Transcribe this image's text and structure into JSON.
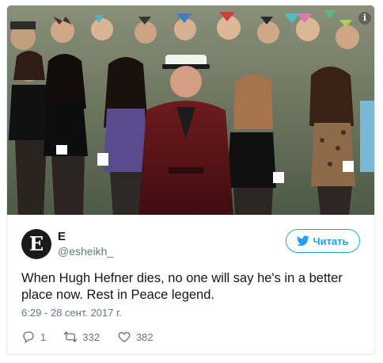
{
  "media": {
    "info_icon": "info-icon"
  },
  "author": {
    "avatar_letter": "E",
    "name": "E",
    "handle": "@esheikh_"
  },
  "follow": {
    "label": "Читать",
    "icon": "twitter-bird-icon",
    "color": "#1da1f2"
  },
  "tweet": {
    "text_line1": "When Hugh Hefner dies, no one will say he's in a better",
    "text_line2": "place now. Rest in Peace legend.",
    "timestamp": "6:29 - 28 сент. 2017 г."
  },
  "actions": {
    "replies": "1",
    "retweets": "332",
    "likes": "382"
  }
}
